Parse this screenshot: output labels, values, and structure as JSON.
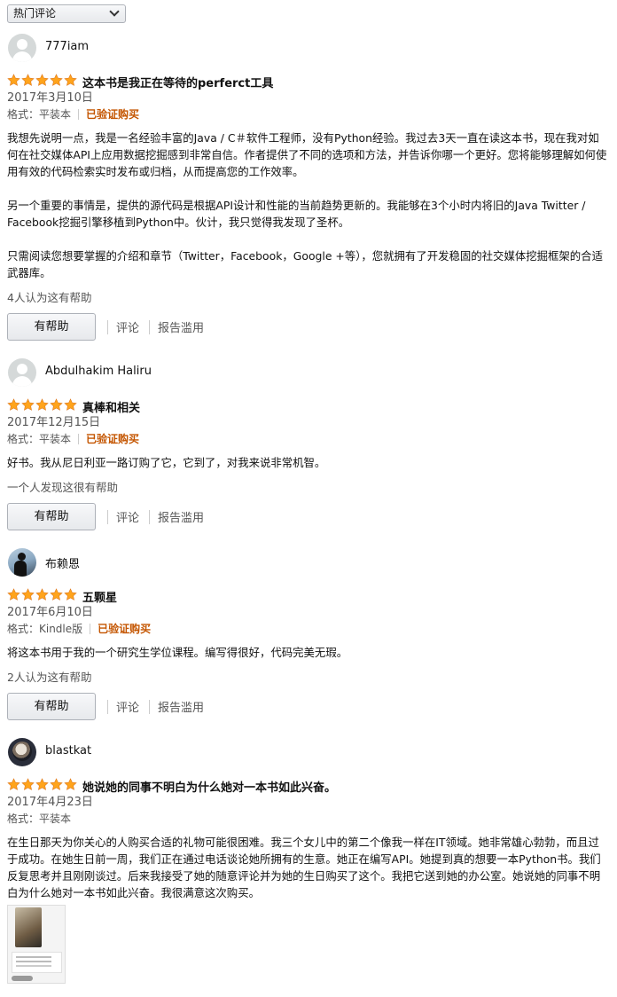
{
  "sort": {
    "label": "热门评论"
  },
  "reviews": [
    {
      "author": "777iam",
      "avatar": "default-avatar",
      "rating": 5,
      "title": "这本书是我正在等待的perferct工具",
      "date": "2017年3月10日",
      "format": "格式：平装本",
      "verified": "已验证购买",
      "body": [
        "我想先说明一点，我是一名经验丰富的Java / C＃软件工程师，没有Python经验。我过去3天一直在读这本书，现在我对如何在社交媒体API上应用数据挖掘感到非常自信。作者提供了不同的选项和方法，并告诉你哪一个更好。您将能够理解如何使用有效的代码检索实时发布或归档，从而提高您的工作效率。",
        "另一个重要的事情是，提供的源代码是根据API设计和性能的当前趋势更新的。我能够在3个小时内将旧的Java Twitter / Facebook挖掘引擎移植到Python中。伙计，我只觉得我发现了圣杯。",
        "只需阅读您想要掌握的介绍和章节（Twitter，Facebook，Google +等），您就拥有了开发稳固的社交媒体挖掘框架的合适武器库。"
      ],
      "helpful_count": "4人认为这有帮助"
    },
    {
      "author": "Abdulhakim Haliru",
      "avatar": "default-avatar",
      "rating": 5,
      "title": "真棒和相关",
      "date": "2017年12月15日",
      "format": "格式：平装本",
      "verified": "已验证购买",
      "body": [
        "好书。我从尼日利亚一路订购了它，它到了，对我来说非常机智。"
      ],
      "helpful_count": "一个人发现这很有帮助"
    },
    {
      "author": "布赖恩",
      "avatar": "photo-avatar",
      "rating": 5,
      "title": "五颗星",
      "date": "2017年6月10日",
      "format": "格式：Kindle版",
      "verified": "已验证购买",
      "body": [
        "将这本书用于我的一个研究生学位课程。编写得很好，代码完美无瑕。"
      ],
      "helpful_count": "2人认为这有帮助"
    },
    {
      "author": "blastkat",
      "avatar": "photo-avatar",
      "rating": 5,
      "title": "她说她的同事不明白为什么她对一本书如此兴奋。",
      "date": "2017年4月23日",
      "format": "格式：平装本",
      "verified": "",
      "body": [
        "在生日那天为你关心的人购买合适的礼物可能很困难。我三个女儿中的第二个像我一样在IT领域。她非常雄心勃勃，而且过于成功。在她生日前一周，我们正在通过电话谈论她所拥有的生意。她正在编写API。她提到真的想要一本Python书。我们反复思考并且刚刚谈过。后来我接受了她的随意评论并为她的生日购买了这个。我把它送到她的办公室。她说她的同事不明白为什么她对一本书如此兴奋。我很满意这次购买。"
      ],
      "helpful_count": ""
    }
  ],
  "actions": {
    "helpful": "有帮助",
    "comment": "评论",
    "report": "报告滥用"
  },
  "colors": {
    "star": "#ffa41c",
    "verified": "#c45500",
    "muted_text": "#555555"
  },
  "review_image": "customer-photo-thumbnail"
}
